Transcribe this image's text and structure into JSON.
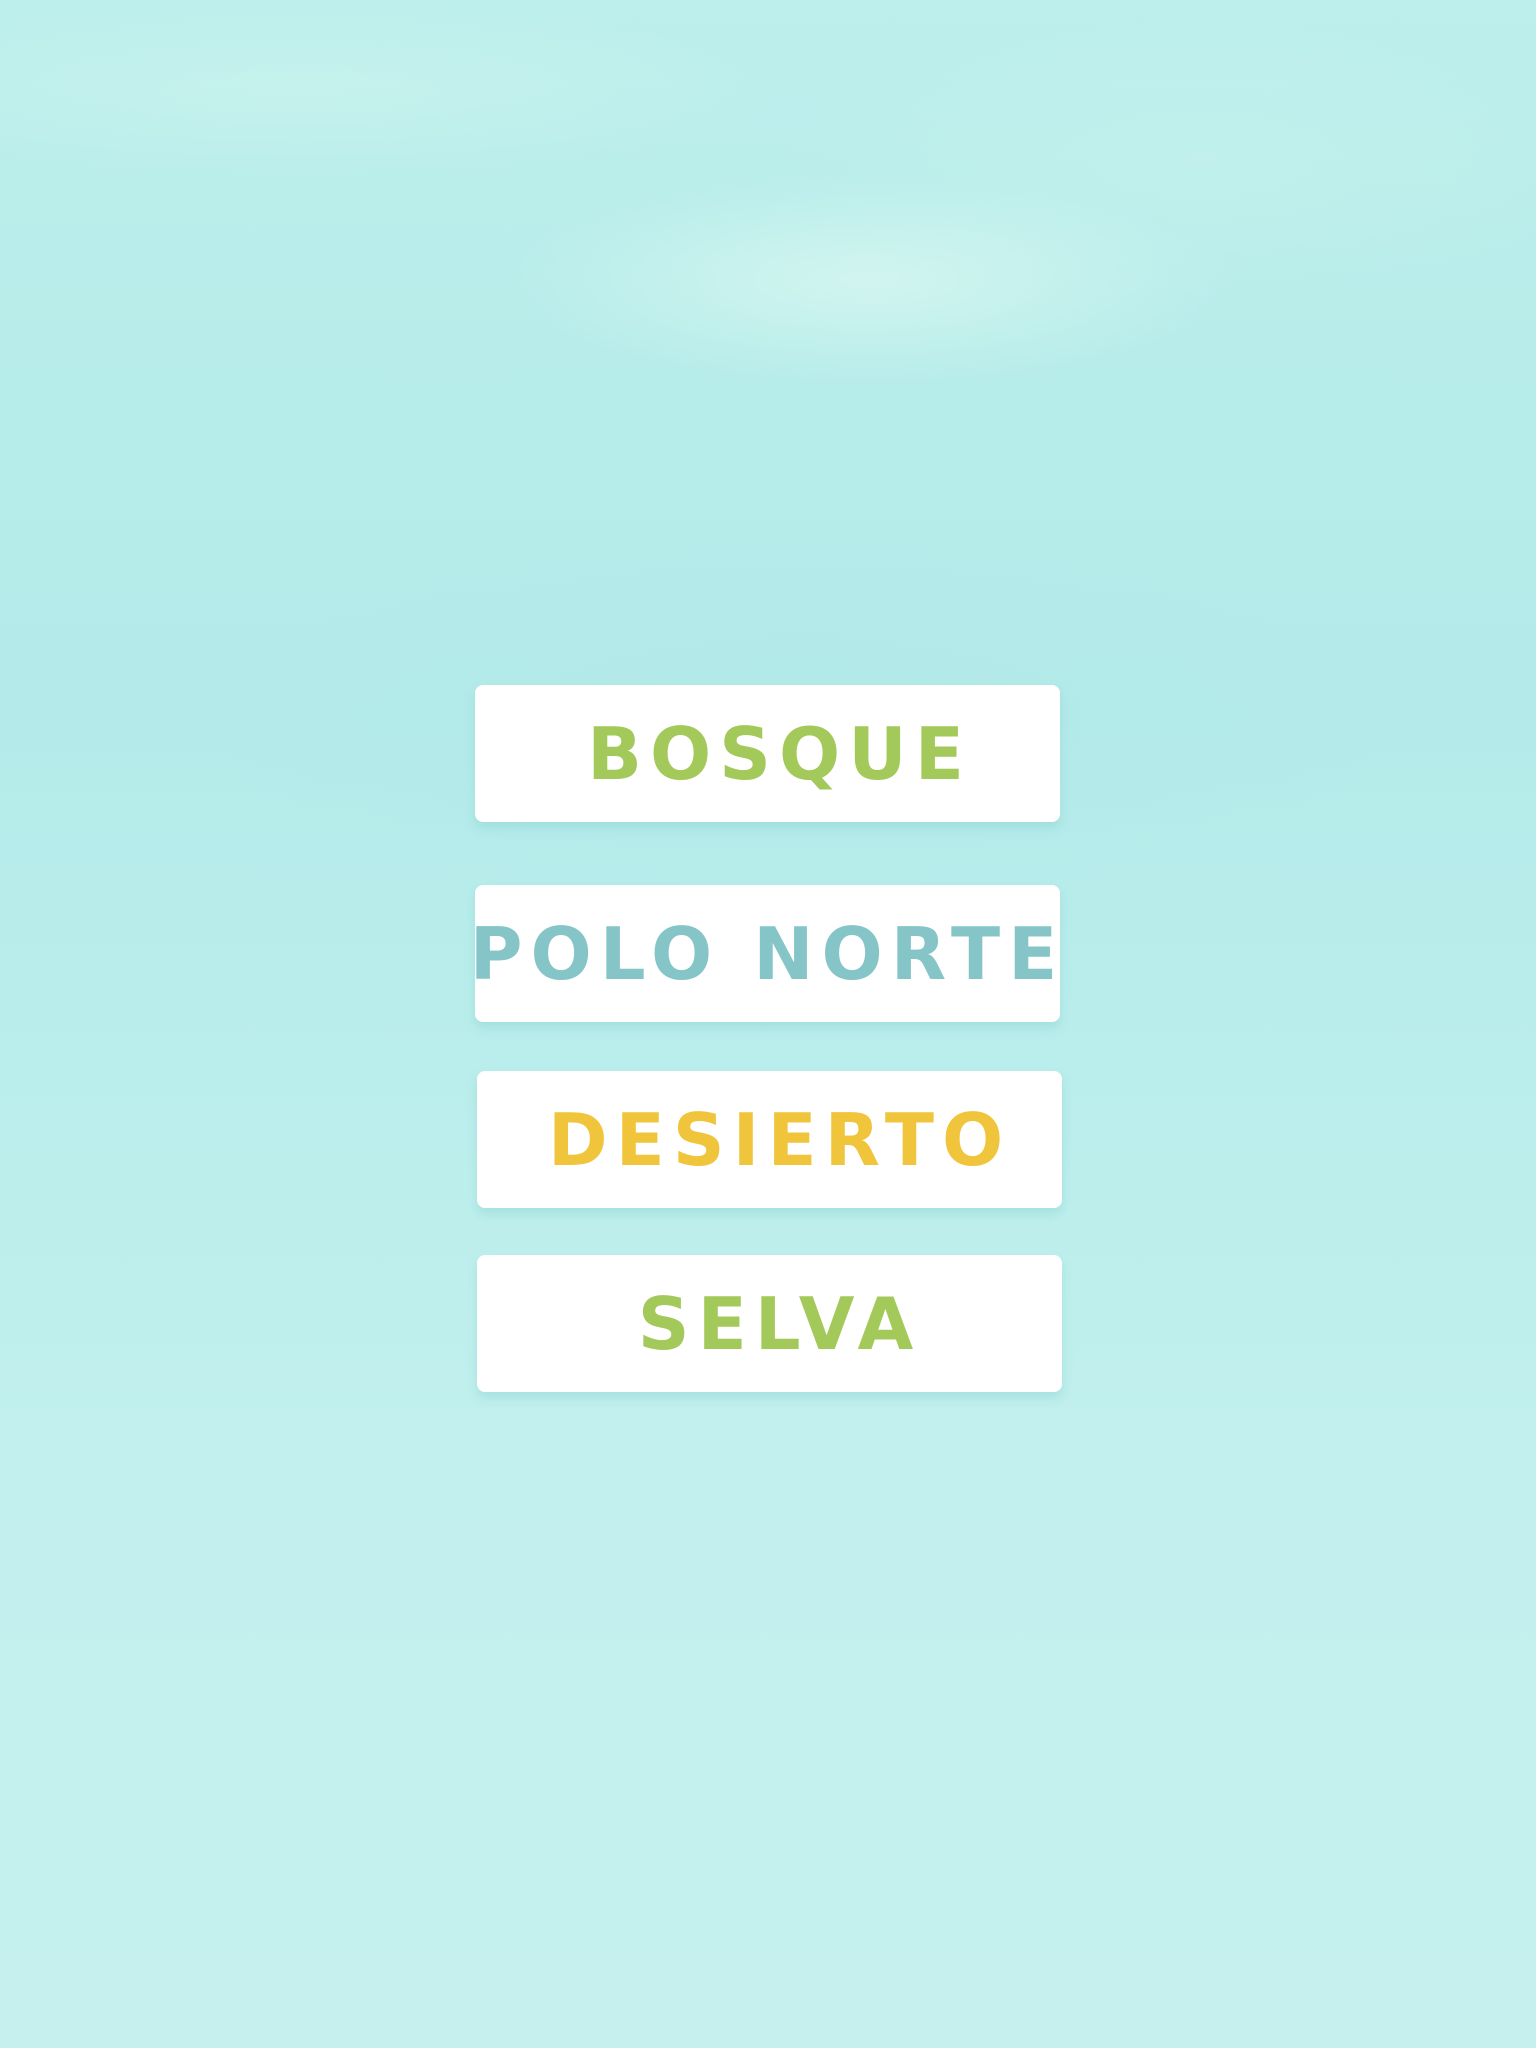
{
  "colors": {
    "background": "#b8edeb",
    "button_bg": "#ffffff",
    "green": "#a3c95a",
    "teal": "#86c5c7",
    "yellow": "#f0c53c"
  },
  "menu": {
    "items": [
      {
        "id": "bosque",
        "label": "BOSQUE",
        "color": "#a3c95a"
      },
      {
        "id": "polo",
        "label": "POLO NORTE",
        "color": "#86c5c7"
      },
      {
        "id": "desierto",
        "label": "DESIERTO",
        "color": "#f0c53c"
      },
      {
        "id": "selva",
        "label": "SELVA",
        "color": "#a3c95a"
      }
    ]
  }
}
